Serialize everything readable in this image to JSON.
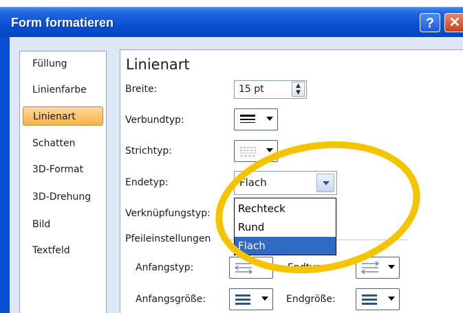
{
  "window": {
    "title": "Form formatieren",
    "help_label": "?",
    "close_label": "✕"
  },
  "sidebar": {
    "items": [
      {
        "label": "Füllung"
      },
      {
        "label": "Linienfarbe"
      },
      {
        "label": "Linienart",
        "selected": true
      },
      {
        "label": "Schatten"
      },
      {
        "label": "3D-Format"
      },
      {
        "label": "3D-Drehung"
      },
      {
        "label": "Bild"
      },
      {
        "label": "Textfeld"
      }
    ]
  },
  "linienart": {
    "heading": "Linienart",
    "breite": {
      "label": "Breite:",
      "value": "15 pt"
    },
    "verbundtyp": {
      "label": "Verbundtyp:",
      "icon": "compound-lines-icon"
    },
    "strichtyp": {
      "label": "Strichtyp:",
      "icon": "dash-type-icon"
    },
    "endetyp": {
      "label": "Endetyp:",
      "value": "Flach",
      "options": [
        "Rechteck",
        "Rund",
        "Flach"
      ],
      "selected_option": "Flach"
    },
    "verknuepfungstyp": {
      "label": "Verknüpfungstyp:"
    },
    "pfeileinstellungen": {
      "heading": "Pfeileinstellungen",
      "anfangstyp": {
        "label": "Anfangstyp:",
        "icon": "arrow-type-icon"
      },
      "endtyp": {
        "label": "Endtyp:",
        "icon": "arrow-type-icon"
      },
      "anfangsgroesse": {
        "label": "Anfangsgröße:",
        "icon": "arrow-size-icon"
      },
      "endgroesse": {
        "label": "Endgröße:",
        "icon": "arrow-size-icon"
      }
    }
  },
  "highlight": {
    "color": "#f5c400"
  }
}
